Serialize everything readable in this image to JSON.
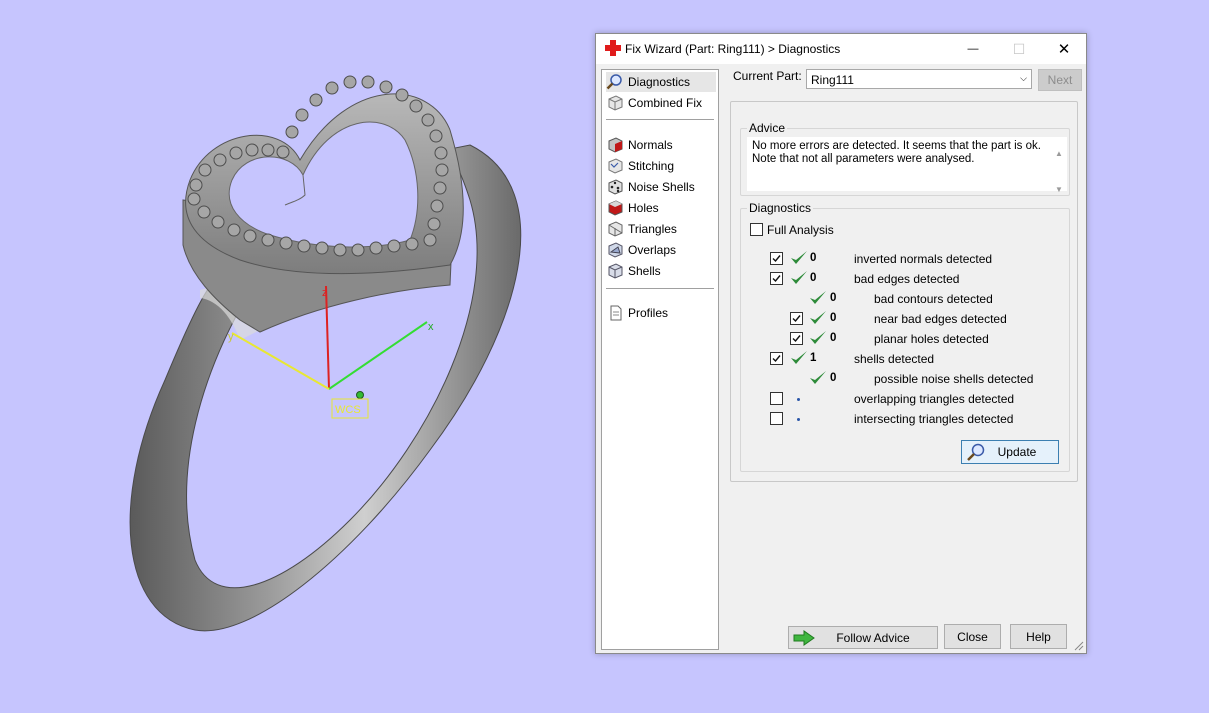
{
  "viewport": {
    "axis_labels": {
      "x": "x",
      "y": "y",
      "z": "z"
    },
    "wcs_label": "WCS"
  },
  "window": {
    "title": "Fix Wizard (Part: Ring111) > Diagnostics",
    "minimize_label": "—",
    "maximize_label": "☐",
    "close_label": "✕"
  },
  "nav": {
    "items": [
      {
        "label": "Diagnostics",
        "icon": "magnifier-icon"
      },
      {
        "label": "Combined Fix",
        "icon": "cube-icon"
      },
      {
        "label": "Normals",
        "icon": "normals-cube-icon"
      },
      {
        "label": "Stitching",
        "icon": "stitching-icon"
      },
      {
        "label": "Noise Shells",
        "icon": "dice-icon"
      },
      {
        "label": "Holes",
        "icon": "hole-cube-icon"
      },
      {
        "label": "Triangles",
        "icon": "triangle-icon"
      },
      {
        "label": "Overlaps",
        "icon": "overlap-icon"
      },
      {
        "label": "Shells",
        "icon": "shell-icon"
      },
      {
        "label": "Profiles",
        "icon": "document-icon"
      }
    ]
  },
  "header": {
    "current_part_label": "Current Part:",
    "current_part_value": "Ring111",
    "next_label": "Next"
  },
  "advice": {
    "title": "Advice",
    "line1": "No more errors are detected. It seems that the part is ok.",
    "line2": "Note that not all parameters were analysed."
  },
  "diagnostics": {
    "title": "Diagnostics",
    "full_analysis_label": "Full Analysis",
    "rows": [
      {
        "count": "0",
        "label": "inverted normals detected"
      },
      {
        "count": "0",
        "label": "bad edges detected"
      },
      {
        "count": "0",
        "label": "bad contours detected"
      },
      {
        "count": "0",
        "label": "near bad edges detected"
      },
      {
        "count": "0",
        "label": "planar holes detected"
      },
      {
        "count": "1",
        "label": "shells detected"
      },
      {
        "count": "0",
        "label": "possible noise shells detected"
      },
      {
        "count": "",
        "label": "overlapping triangles detected"
      },
      {
        "count": "",
        "label": "intersecting triangles detected"
      }
    ],
    "update_label": "Update"
  },
  "footer": {
    "follow_advice_label": "Follow Advice",
    "close_label": "Close",
    "help_label": "Help"
  },
  "colors": {
    "background": "#c6c5fe",
    "check_green": "#2e8b3a",
    "axis_x": "#33dd33",
    "axis_y": "#e8e832",
    "axis_z": "#dd2222"
  }
}
